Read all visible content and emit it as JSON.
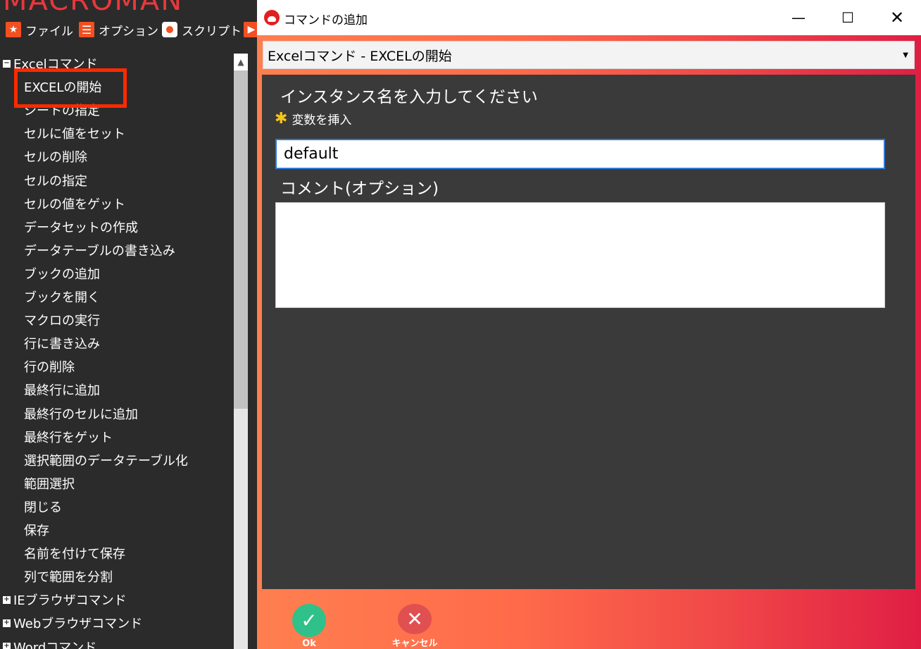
{
  "app": {
    "title": "MACROMAN"
  },
  "menubar": {
    "file": "ファイル",
    "options": "オプション",
    "script": "スクリプト"
  },
  "tree": {
    "groups": [
      {
        "label": "Excelコマンド",
        "expander": "−"
      },
      {
        "label": "IEブラウザコマンド",
        "expander": "+"
      },
      {
        "label": "Webブラウザコマンド",
        "expander": "+"
      },
      {
        "label": "Wordコマンド",
        "expander": "+"
      }
    ],
    "excel_items": [
      "EXCELの開始",
      "シートの指定",
      "セルに値をセット",
      "セルの削除",
      "セルの指定",
      "セルの値をゲット",
      "データセットの作成",
      "データテーブルの書き込み",
      "ブックの追加",
      "ブックを開く",
      "マクロの実行",
      "行に書き込み",
      "行の削除",
      "最終行に追加",
      "最終行のセルに追加",
      "最終行をゲット",
      "選択範囲のデータテーブル化",
      "範囲選択",
      "閉じる",
      "保存",
      "名前を付けて保存",
      "列で範囲を分割"
    ],
    "selected_index": 0,
    "highlight_color": "#ff2a00"
  },
  "dialog": {
    "title": "コマンドの追加",
    "window_buttons": {
      "minimize": "—",
      "maximize": "☐",
      "close": "✕"
    },
    "command_select": {
      "value": "Excelコマンド - EXCELの開始",
      "arrow": "▼"
    },
    "instance_label": "インスタンス名を入力してください",
    "insert_variable": {
      "icon": "✱",
      "label": "変数を挿入"
    },
    "instance_input": {
      "value": "default"
    },
    "comment_label": "コメント(オプション)",
    "comment_value": "",
    "ok": {
      "icon": "✓",
      "label": "Ok",
      "color": "#30c08a"
    },
    "cancel": {
      "icon": "✕",
      "label": "キャンセル",
      "color": "#e05050"
    }
  }
}
